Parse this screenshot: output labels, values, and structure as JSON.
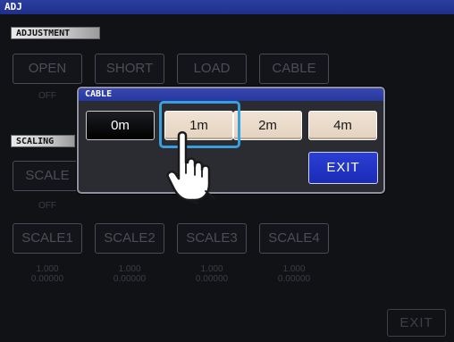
{
  "window": {
    "title": "ADJ"
  },
  "sections": {
    "adjustment_label": "ADJUSTMENT",
    "scaling_label": "SCALING"
  },
  "adjustment": {
    "open_label": "OPEN",
    "open_value": "OFF",
    "short_label": "SHORT",
    "load_label": "LOAD",
    "cable_label": "CABLE"
  },
  "scaling": {
    "scale_label": "SCALE",
    "scale_value": "OFF",
    "scale1_label": "SCALE1",
    "scale2_label": "SCALE2",
    "scale3_label": "SCALE3",
    "scale4_label": "SCALE4",
    "values": [
      {
        "a": "1.000",
        "b": "0.00000"
      },
      {
        "a": "1.000",
        "b": "0.00000"
      },
      {
        "a": "1.000",
        "b": "0.00000"
      },
      {
        "a": "1.000",
        "b": "0.00000"
      }
    ]
  },
  "dialog": {
    "title": "CABLE",
    "options": [
      "0m",
      "1m",
      "2m",
      "4m"
    ],
    "selected": "0m",
    "pressed": "1m",
    "exit_label": "EXIT"
  },
  "footer": {
    "exit_label": "EXIT"
  },
  "colors": {
    "titlebar": "#1f2f8a",
    "dialog_title": "#2637a0",
    "exit_button": "#1b2bb6",
    "option_button": "#e3d2bf",
    "highlight_ring": "#3aa0dd"
  },
  "icons": {
    "pointer": "pointing-hand-icon"
  }
}
